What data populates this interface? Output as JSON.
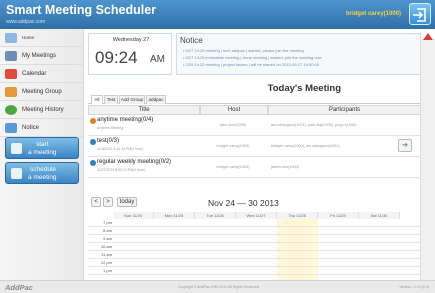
{
  "header": {
    "title": "Smart Meeting Scheduler",
    "url": "www.addpac.com",
    "user": "bridget carey(1000)"
  },
  "sidebar": {
    "items": [
      {
        "label": "Home",
        "icon": "home-icon"
      },
      {
        "label": "My Meetings",
        "icon": "meetings-icon"
      },
      {
        "label": "Calendar",
        "icon": "calendar-icon"
      },
      {
        "label": "Meeting Group",
        "icon": "group-icon"
      },
      {
        "label": "Meeting History",
        "icon": "history-icon"
      },
      {
        "label": "Notice",
        "icon": "notice-icon"
      }
    ],
    "start_btn": {
      "line1": "start",
      "line2": "a meeting"
    },
    "schedule_btn": {
      "line1": "schedule",
      "line2": "a meeting"
    }
  },
  "clock": {
    "date": "Wednesday 27",
    "time": "09:24",
    "ampm": "AM"
  },
  "notice": {
    "title": "Notice",
    "lines": [
      "• 9/27 14:25  meeting | tech addpac | started, please join the meeting",
      "• 9/27 14:25  immediate meeting | issue meeting | started, join the meeting now",
      "• 2/29 14:22  meeting | project issues | will be started on 2013-09-27 14:00:00"
    ]
  },
  "today": {
    "title": "Today's Meeting",
    "tabs": [
      "All",
      "Test",
      "Add Group",
      "addpac"
    ],
    "columns": [
      "Title",
      "Host",
      "Participants"
    ],
    "rows": [
      {
        "title": "anytime meeting(0/4)",
        "sub": "Anytime Meeting",
        "host": "paul lone(1000)",
        "participants": "ann changsoo(1001), park suji(1005), jung n(1006)",
        "icon_color": "#e67e22"
      },
      {
        "title": "test(0/3)",
        "sub": "11/8/2013 4:41:12 PM(1 hour)",
        "host": "bridget carey(1000)",
        "participants": "bridget carey(1000), lee changsoo(1001)",
        "icon_color": "#2c7fc1",
        "enter": "➔"
      },
      {
        "title": "regular weekly meeting(0/2)",
        "sub": "11/27/2013 5:00:13 PM(1 hour)",
        "host": "bridget carey(1000)",
        "participants": "james kim(1000)",
        "icon_color": "#2c7fc1"
      }
    ]
  },
  "calendar": {
    "prev": "<",
    "next": ">",
    "today_btn": "today",
    "range": "Nov 24 — 30 2013",
    "days": [
      "Sun 11/24",
      "Mon 11/25",
      "Tue 11/26",
      "Wed 11/27",
      "Thu 11/28",
      "Fri 11/29",
      "Sat 11/30"
    ],
    "hours": [
      "7 pm",
      "8 am",
      "9 am",
      "10 am",
      "11 am",
      "12 pm",
      "1 pm"
    ]
  },
  "footer": {
    "brand": "AddPac",
    "copyright": "Copyright © AddPac 1999-2013 All Rights Reserved",
    "version": "Version : 1.0.1(0.0)"
  },
  "colors": {
    "header": "#3a7fbe",
    "user_name": "#f4d23a",
    "today_highlight": "#fff7d6",
    "scroll_arrow": "#e53935"
  }
}
